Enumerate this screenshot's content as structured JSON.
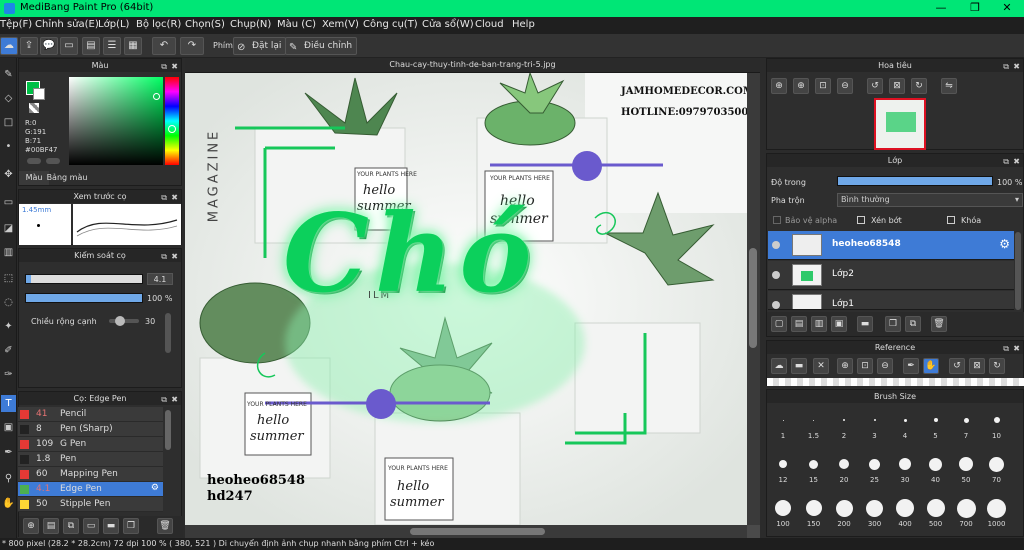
{
  "window": {
    "title": "MediBang Paint Pro (64bit)"
  },
  "menu": [
    "Tệp(F)",
    "Chỉnh sửa(E)",
    "Lớp(L)",
    "Bộ lọc(R)",
    "Chọn(S)",
    "Chụp(N)",
    "Màu (C)",
    "Xem(V)",
    "Công cụ(T)",
    "Cửa sổ(W)",
    "Cloud",
    "Help"
  ],
  "toolbar": {
    "phim_label": "Phím",
    "reset_label": "Đặt lại",
    "adjust_label": "Điều chỉnh"
  },
  "color_panel": {
    "title": "Màu",
    "r": "R:0",
    "g": "G:191",
    "b": "B:71",
    "hex": "#00BF47",
    "tab_color": "Màu",
    "tab_palette": "Bảng màu",
    "current_color": "#00BF47"
  },
  "preview_panel": {
    "title": "Xem trước cọ",
    "size": "1.45mm"
  },
  "brush_control": {
    "title": "Kiểm soát cọ",
    "size_value": "4.1",
    "opacity_value": "100 %",
    "opacity_fraction": 1.0,
    "size_fraction": 0.04,
    "edge_label": "Chiều rộng cạnh",
    "edge_value": "30"
  },
  "brush_list": {
    "title": "Cọ: Edge Pen",
    "items": [
      {
        "size": "41",
        "name": "Pencil",
        "color": "#e53935"
      },
      {
        "size": "8",
        "name": "Pen (Sharp)",
        "color": "#222222"
      },
      {
        "size": "109",
        "name": "G Pen",
        "color": "#e53935"
      },
      {
        "size": "1.8",
        "name": "Pen",
        "color": "#222222"
      },
      {
        "size": "60",
        "name": "Mapping Pen",
        "color": "#e53935"
      },
      {
        "size": "4.1",
        "name": "Edge Pen",
        "color": "#4caf50",
        "selected": true
      },
      {
        "size": "50",
        "name": "Stipple Pen",
        "color": "#fdd835"
      }
    ]
  },
  "document": {
    "tab_title": "Chau-cay-thuy-tinh-de-ban-trang-tri-5.jpg"
  },
  "artwork": {
    "brand": "JAMHOMEDECOR.COM",
    "hotline": "HOTLINE:0979703500",
    "big_text": "Chó",
    "sign1": "heoheo68548",
    "sign2": "hd247",
    "magazine": "MAGAZINE",
    "pot_label": "YOUR PLANTS HERE",
    "pot_text1": "hello",
    "pot_text2": "summer",
    "film": "ILM"
  },
  "navigator": {
    "title": "Hoa tiêu"
  },
  "layers": {
    "title": "Lớp",
    "opacity_label": "Độ trong",
    "opacity_value": "100 %",
    "opacity_fraction": 1.0,
    "blend_label": "Pha trộn",
    "blend_value": "Bình thường",
    "protect_alpha": "Bảo vệ alpha",
    "clipping": "Xén bớt",
    "lock": "Khóa",
    "items": [
      {
        "name": "heoheo68548",
        "selected": true
      },
      {
        "name": "Lớp2"
      },
      {
        "name": "Lớp1"
      }
    ]
  },
  "reference": {
    "title": "Reference"
  },
  "brush_size": {
    "title": "Brush Size",
    "sizes": [
      "1",
      "1.5",
      "2",
      "3",
      "4",
      "5",
      "7",
      "10",
      "12",
      "15",
      "20",
      "25",
      "30",
      "40",
      "50",
      "70",
      "100",
      "150",
      "200",
      "300",
      "400",
      "500",
      "700",
      "1000"
    ]
  },
  "status": {
    "text": "* 800 pixel  (28.2 * 28.2cm)  72 dpi  100 %  ( 380, 521 )  Di chuyển định ảnh chụp nhanh bằng phím Ctrl + kéo"
  }
}
